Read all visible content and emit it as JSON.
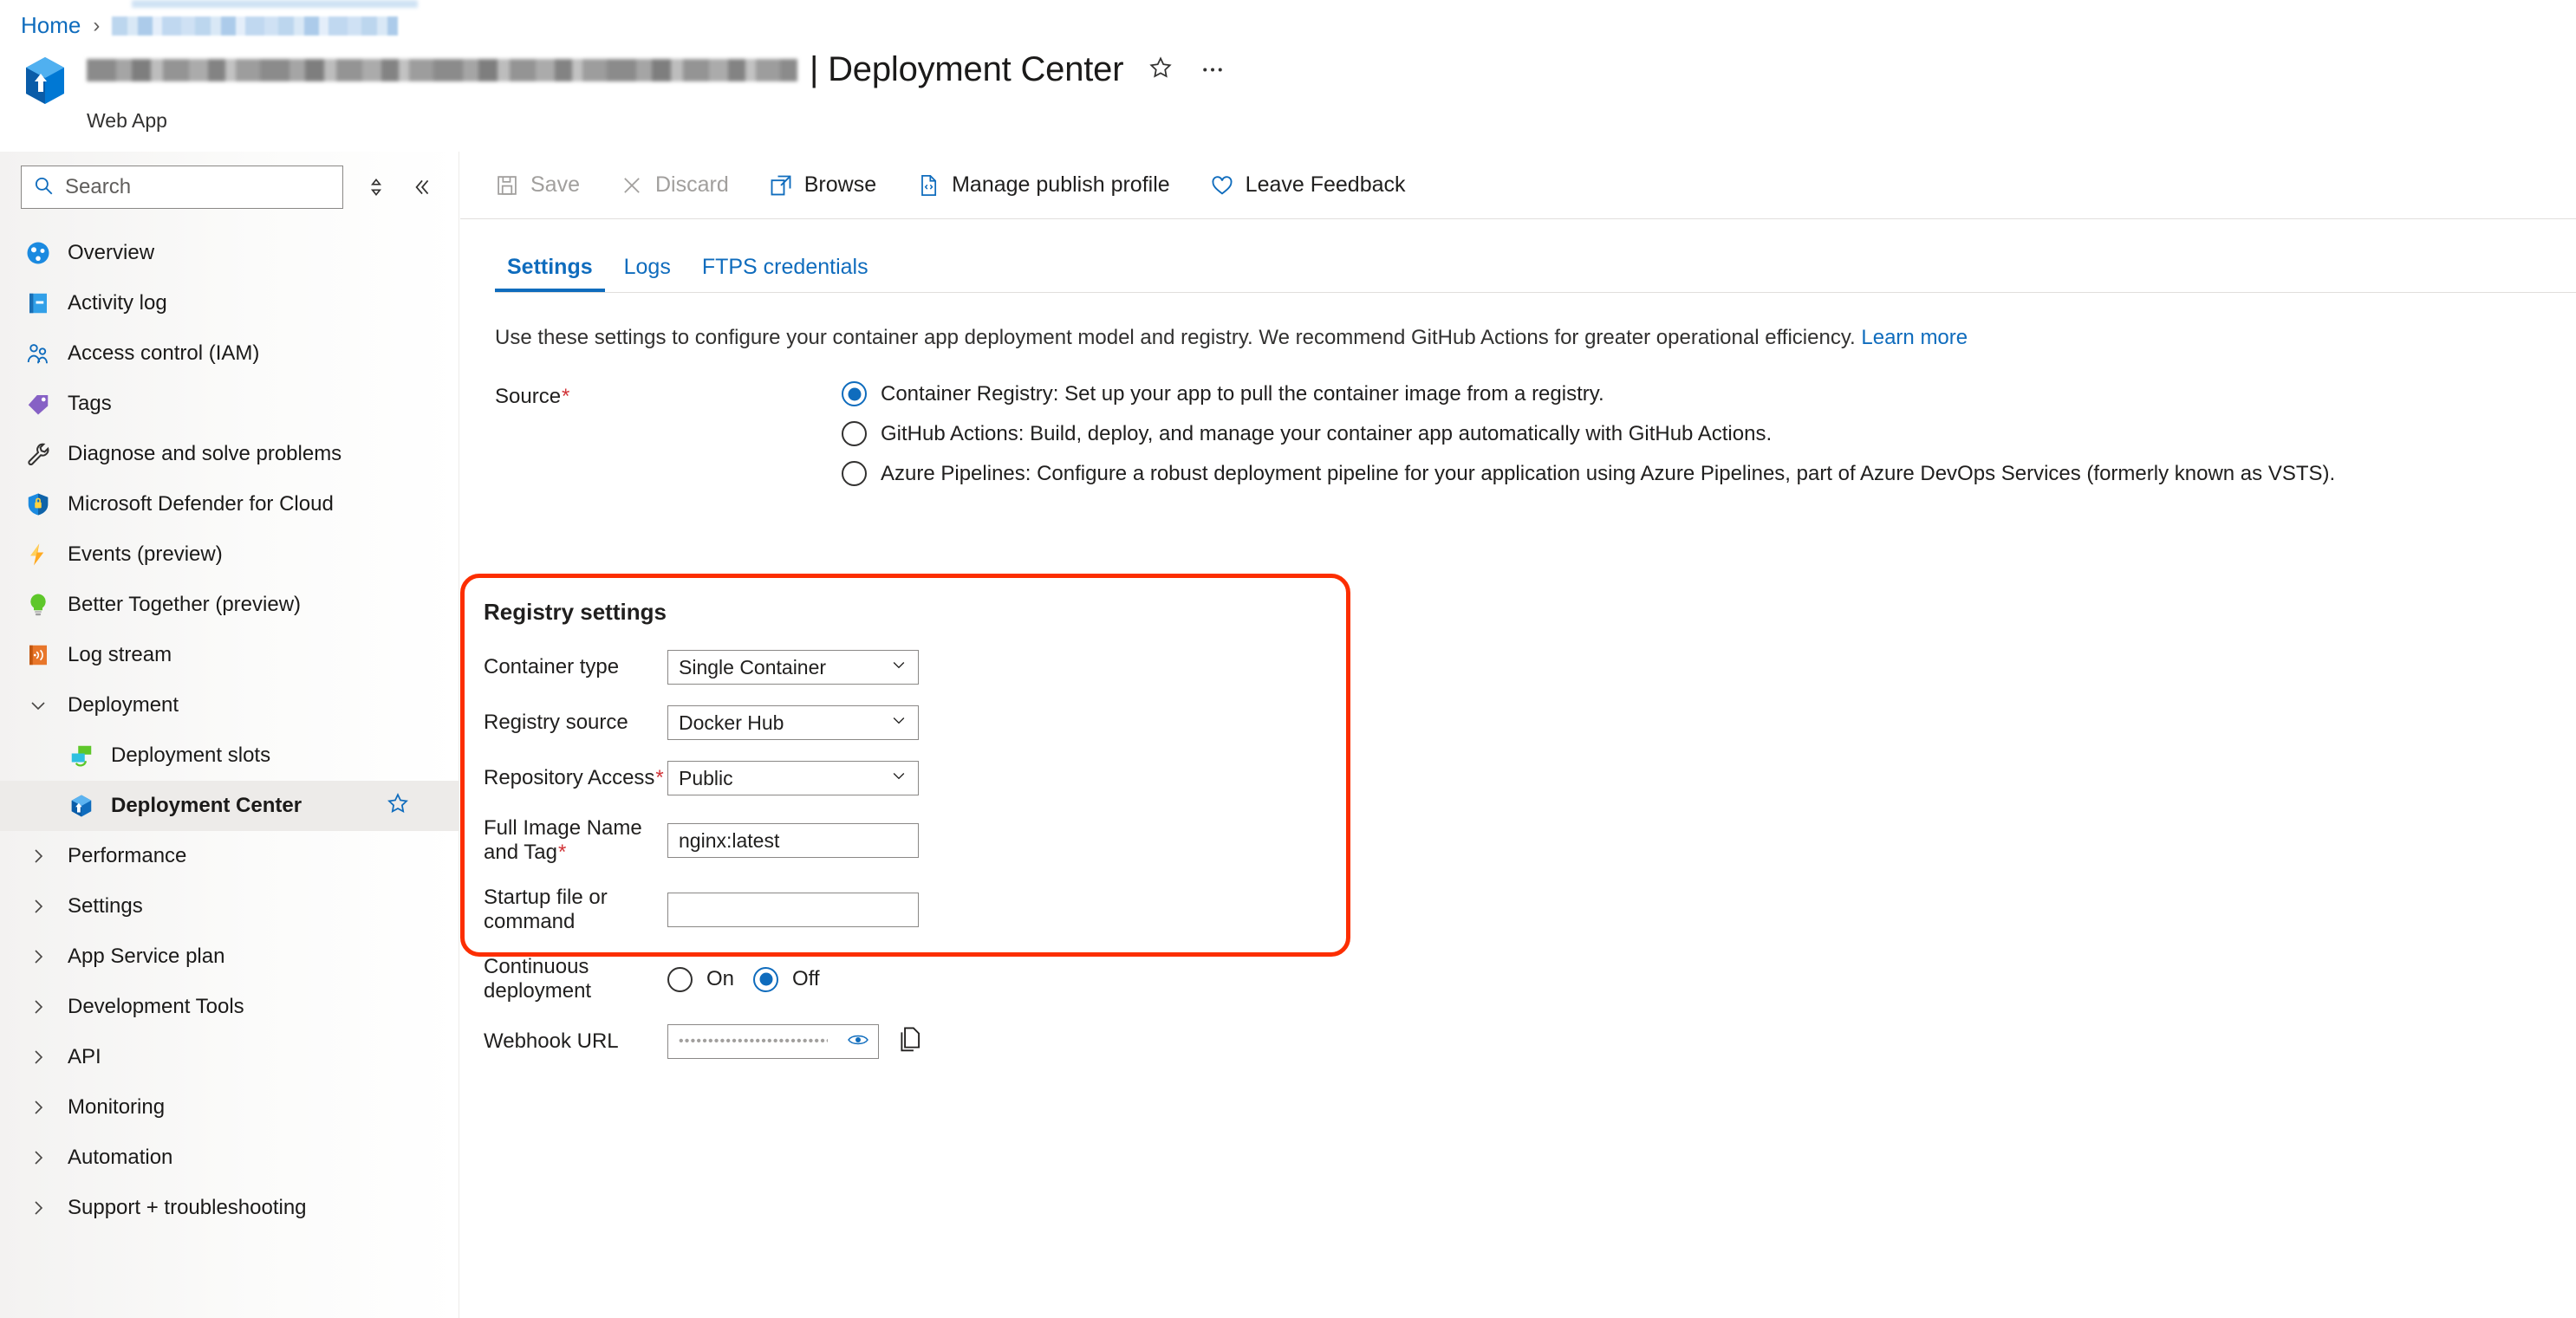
{
  "breadcrumb": {
    "home": "Home",
    "separator": "›",
    "redacted_resource": ""
  },
  "header": {
    "resource_name_redacted": "",
    "title": "| Deployment Center",
    "subtitle": "Web App",
    "favorite_icon": "star-icon",
    "more_icon": "ellipsis-icon",
    "resource_icon": "web-app-icon"
  },
  "sidebar": {
    "search": {
      "placeholder": "Search",
      "icon": "search-icon"
    },
    "sort_icon": "sort-icon",
    "collapse_icon": "double-chevron-left-icon",
    "items": [
      {
        "label": "Overview",
        "icon": "overview-icon",
        "type": "item"
      },
      {
        "label": "Activity log",
        "icon": "activity-log-icon",
        "type": "item"
      },
      {
        "label": "Access control (IAM)",
        "icon": "access-control-icon",
        "type": "item"
      },
      {
        "label": "Tags",
        "icon": "tags-icon",
        "type": "item"
      },
      {
        "label": "Diagnose and solve problems",
        "icon": "wrench-icon",
        "type": "item"
      },
      {
        "label": "Microsoft Defender for Cloud",
        "icon": "shield-lock-icon",
        "type": "item"
      },
      {
        "label": "Events (preview)",
        "icon": "lightning-icon",
        "type": "item"
      },
      {
        "label": "Better Together (preview)",
        "icon": "lightbulb-icon",
        "type": "item"
      },
      {
        "label": "Log stream",
        "icon": "log-stream-icon",
        "type": "item"
      },
      {
        "label": "Deployment",
        "icon": "chevron-down-icon",
        "type": "group-expanded"
      },
      {
        "label": "Deployment slots",
        "icon": "deployment-slots-icon",
        "type": "sub"
      },
      {
        "label": "Deployment Center",
        "icon": "deployment-center-icon",
        "type": "sub-selected",
        "favorite": "star-icon"
      },
      {
        "label": "Performance",
        "icon": "chevron-right-icon",
        "type": "group"
      },
      {
        "label": "Settings",
        "icon": "chevron-right-icon",
        "type": "group"
      },
      {
        "label": "App Service plan",
        "icon": "chevron-right-icon",
        "type": "group"
      },
      {
        "label": "Development Tools",
        "icon": "chevron-right-icon",
        "type": "group"
      },
      {
        "label": "API",
        "icon": "chevron-right-icon",
        "type": "group"
      },
      {
        "label": "Monitoring",
        "icon": "chevron-right-icon",
        "type": "group"
      },
      {
        "label": "Automation",
        "icon": "chevron-right-icon",
        "type": "group"
      },
      {
        "label": "Support + troubleshooting",
        "icon": "chevron-right-icon",
        "type": "group"
      }
    ]
  },
  "toolbar": {
    "save_label": "Save",
    "save_icon": "save-icon",
    "save_disabled": true,
    "discard_label": "Discard",
    "discard_icon": "discard-x-icon",
    "discard_disabled": true,
    "browse_label": "Browse",
    "browse_icon": "browse-external-icon",
    "publish_profile_label": "Manage publish profile",
    "publish_profile_icon": "code-file-icon",
    "feedback_label": "Leave Feedback",
    "feedback_icon": "heart-icon"
  },
  "tabs": [
    {
      "label": "Settings",
      "active": true
    },
    {
      "label": "Logs",
      "active": false
    },
    {
      "label": "FTPS credentials",
      "active": false
    }
  ],
  "content": {
    "description": "Use these settings to configure your container app deployment model and registry. We recommend GitHub Actions for greater operational efficiency.",
    "learn_more": "Learn more",
    "source": {
      "label": "Source",
      "required": true,
      "options": [
        {
          "label": "Container Registry: Set up your app to pull the container image from a registry.",
          "selected": true
        },
        {
          "label": "GitHub Actions: Build, deploy, and manage your container app automatically with GitHub Actions.",
          "selected": false
        },
        {
          "label": "Azure Pipelines: Configure a robust deployment pipeline for your application using Azure Pipelines, part of Azure DevOps Services (formerly known as VSTS).",
          "selected": false
        }
      ]
    },
    "registry_settings": {
      "title": "Registry settings",
      "highlight_color": "#fc2e00",
      "container_type": {
        "label": "Container type",
        "value": "Single Container",
        "control": "dropdown"
      },
      "registry_source": {
        "label": "Registry source",
        "value": "Docker Hub",
        "control": "dropdown"
      },
      "repository_access": {
        "label": "Repository Access",
        "required": true,
        "value": "Public",
        "control": "dropdown"
      },
      "full_image_name": {
        "label": "Full Image Name and Tag",
        "required": true,
        "value": "nginx:latest",
        "control": "text"
      },
      "startup_file": {
        "label": "Startup file or command",
        "value": "",
        "placeholder": "",
        "control": "text"
      },
      "continuous_deployment": {
        "label": "Continuous deployment",
        "options": [
          {
            "label": "On",
            "selected": false
          },
          {
            "label": "Off",
            "selected": true
          }
        ]
      },
      "webhook_url": {
        "label": "Webhook URL",
        "masked_value": "••••••••••••••••••••••••••••••••••",
        "reveal_icon": "eye-icon",
        "copy_icon": "copy-icon"
      }
    }
  },
  "colors": {
    "accent": "#0f6cbd",
    "required_red": "#d13438",
    "highlight_red": "#fc2e00"
  }
}
